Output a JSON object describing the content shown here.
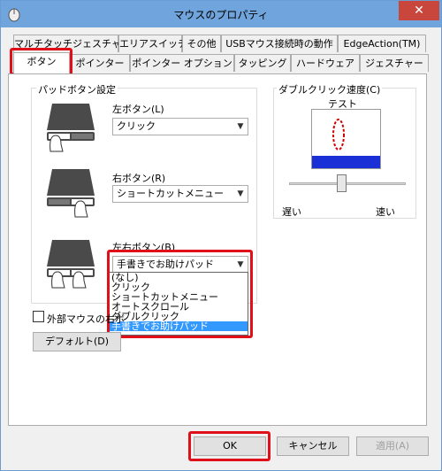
{
  "window": {
    "title": "マウスのプロパティ",
    "close_glyph": "✕"
  },
  "tabs": {
    "row1": [
      "マルチタッチジェスチャー",
      "エリアスイッチ",
      "その他",
      "USBマウス接続時の動作",
      "EdgeAction(TM)"
    ],
    "row2": [
      "ボタン",
      "ポインター",
      "ポインター オプション",
      "タッピング",
      "ハードウェア",
      "ジェスチャー"
    ],
    "active": "ボタン"
  },
  "pad_buttons": {
    "group_title": "パッドボタン設定",
    "left": {
      "label": "左ボタン(L)",
      "value": "クリック"
    },
    "right": {
      "label": "右ボタン(R)",
      "value": "ショートカットメニュー"
    },
    "both": {
      "label": "左右ボタン(B)",
      "value": "手書きでお助けパッド"
    },
    "dropdown_options": [
      "(なし)",
      "クリック",
      "ショートカットメニュー",
      "オートスクロール",
      "ダブルクリック",
      "手書きでお助けパッド"
    ],
    "dropdown_selected_index": 5
  },
  "external_mouse": {
    "label": "外部マウスの右ボ",
    "checked": false
  },
  "default_button": "デフォルト(D)",
  "double_click": {
    "group_title": "ダブルクリック速度(C)",
    "test_label": "テスト",
    "slow": "遅い",
    "fast": "速い",
    "speed_fraction": 0.45
  },
  "footer": {
    "ok": "OK",
    "cancel": "キャンセル",
    "apply": "適用(A)"
  },
  "colors": {
    "highlight_red": "#e0101a",
    "selection_blue": "#3399ff",
    "title_bar": "#6fa5dc"
  }
}
